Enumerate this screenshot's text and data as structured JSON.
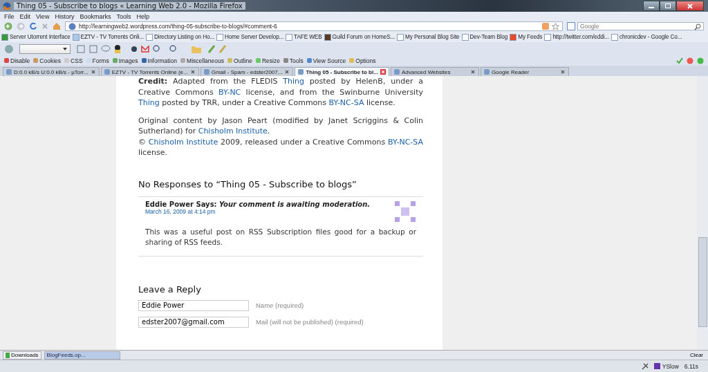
{
  "window": {
    "title": "Thing 05 - Subscribe to blogs « Learning Web 2.0 - Mozilla Firefox"
  },
  "menu": [
    "File",
    "Edit",
    "View",
    "History",
    "Bookmarks",
    "Tools",
    "Help"
  ],
  "address_bar": {
    "url": "http://learningweb2.wordpress.com/thing-05-subscribe-to-blogs/#comment-6"
  },
  "search": {
    "placeholder": "Google"
  },
  "bookmarks": [
    {
      "label": "Server Utorrent Interface"
    },
    {
      "label": "EZTV - TV Torrents Onli..."
    },
    {
      "label": "Directory Listing on Ho..."
    },
    {
      "label": "Home Server Develop..."
    },
    {
      "label": "TAFE WEB"
    },
    {
      "label": "Guild Forum on HomeS..."
    },
    {
      "label": "My Personal Blog Site"
    },
    {
      "label": "Dev-Team Blog"
    },
    {
      "label": "My Feeds"
    },
    {
      "label": "http://twitter.com/eddi..."
    },
    {
      "label": "chronicdev - Google Co..."
    }
  ],
  "dev_toolbar": [
    "Disable",
    "Cookies",
    "CSS",
    "Forms",
    "Images",
    "Information",
    "Miscellaneous",
    "Outline",
    "Resize",
    "Tools",
    "View Source",
    "Options"
  ],
  "tabs": [
    {
      "label": "D:0.0 kB/s U:0.0 kB/s - µTorr...",
      "selected": false
    },
    {
      "label": "EZTV - TV Torrents Online (e...",
      "selected": false
    },
    {
      "label": "Gmail - Spam - edster2007...",
      "selected": false
    },
    {
      "label": "Thing 05 - Subscribe to bl...",
      "selected": true
    },
    {
      "label": "Advanced Websites",
      "selected": false
    },
    {
      "label": "Google Reader",
      "selected": false
    }
  ],
  "article": {
    "paragraphs": [
      [
        [
          {
            "kind": "text",
            "text": "**Credit:** Adapted from the FLEDIS "
          },
          {
            "kind": "link",
            "text": "Thing"
          },
          {
            "kind": "text",
            "text": " posted by HelenB, under a Creative Commons "
          },
          {
            "kind": "link",
            "text": "BY-NC"
          },
          {
            "kind": "text",
            "text": " license, and from the Swinburne University "
          },
          {
            "kind": "link",
            "text": "Thing"
          },
          {
            "kind": "text",
            "text": " posted by TRR, under a Creative Commons "
          },
          {
            "kind": "link",
            "text": "BY-NC-SA"
          },
          {
            "kind": "text",
            "text": " license."
          }
        ]
      ],
      [
        [
          {
            "kind": "text",
            "text": "Original content by Jason Peart (modified by Janet Scriggins & Colin Sutherland) for "
          },
          {
            "kind": "link",
            "text": "Chisholm Institute"
          },
          {
            "kind": "text",
            "text": "."
          }
        ],
        [
          {
            "kind": "text",
            "text": "© "
          },
          {
            "kind": "link",
            "text": "Chisholm Institute"
          },
          {
            "kind": "text",
            "text": " 2009, released under a Creative Commons "
          },
          {
            "kind": "link",
            "text": "BY-NC-SA"
          },
          {
            "kind": "text",
            "text": " license."
          }
        ]
      ]
    ]
  },
  "responses": {
    "heading": "No Responses to “Thing 05 - Subscribe to blogs”",
    "comments": [
      {
        "author": "Eddie Power Says:",
        "note": "Your comment is awaiting moderation.",
        "date": "March 16, 2009 at 4:14 pm",
        "body": "This was a useful post on RSS Subscription files good for a backup or sharing of RSS feeds."
      }
    ]
  },
  "reply_form": {
    "heading": "Leave a Reply",
    "fields": [
      {
        "value": "Eddie Power",
        "label": "Name (required)"
      },
      {
        "value": "edster2007@gmail.com",
        "label": "Mail (will not be published) (required)"
      }
    ]
  },
  "downloads_bar": {
    "label": "Downloads",
    "items": [
      "BlogFeeds.op..."
    ],
    "clear": "Clear"
  },
  "status_bar": {
    "yslow": "YSlow",
    "time": "6.11s"
  }
}
